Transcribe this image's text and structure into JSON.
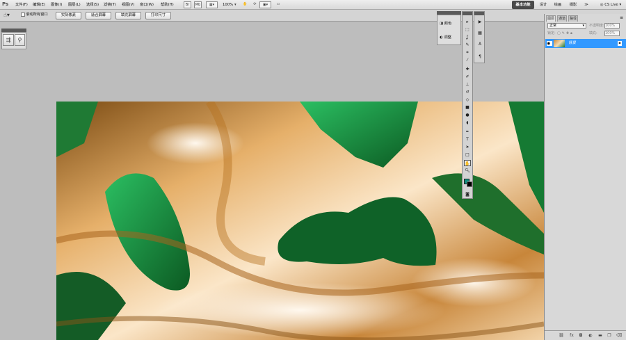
{
  "app": {
    "logo": "Ps"
  },
  "menu": [
    "文件(F)",
    "编辑(E)",
    "图像(I)",
    "图层(L)",
    "选择(S)",
    "滤镜(T)",
    "视图(V)",
    "窗口(W)",
    "帮助(H)"
  ],
  "menubar_tools": {
    "bridge": "Br",
    "minibridge": "Mb",
    "zoom": "100%"
  },
  "workspaces": {
    "essentials": "基本功能",
    "design": "设计",
    "painting": "绘画",
    "photography": "摄影",
    "more": "≫",
    "cslive": "CS Live ▾"
  },
  "options": {
    "scroll_all": "滚动所有窗口",
    "buttons": [
      "实际像素",
      "适合屏幕",
      "填充屏幕",
      "打印尺寸"
    ]
  },
  "mini_panel": {
    "items": [
      "颜色",
      "调整"
    ]
  },
  "layers_panel": {
    "tabs": [
      "图层",
      "通道",
      "路径"
    ],
    "blend_mode": "正常",
    "opacity_label": "不透明度:",
    "opacity": "100%",
    "lock_label": "锁定:",
    "fill_label": "填充:",
    "fill": "100%",
    "layer_name": "背景"
  },
  "colors": {
    "accent": "#3399ff",
    "foreground": "#0f8f80",
    "background": "#000000"
  },
  "icons": [
    "hand-icon",
    "zoom-icon",
    "eye-icon",
    "lock-icon",
    "link-icon",
    "fx-icon",
    "mask-icon",
    "adjustment-icon",
    "folder-icon",
    "new-layer-icon",
    "trash-icon"
  ]
}
